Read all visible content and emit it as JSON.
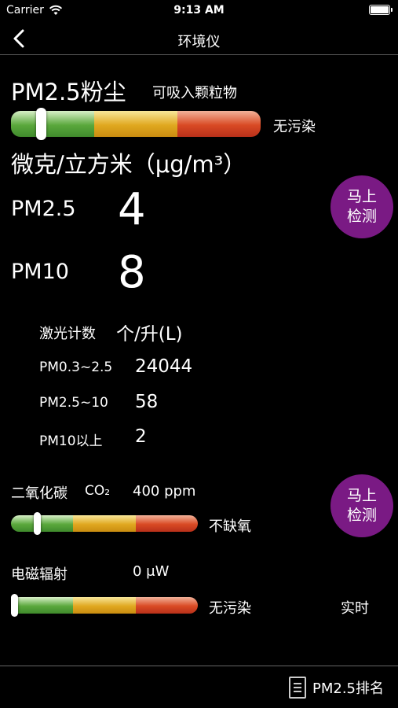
{
  "status_bar": {
    "carrier": "Carrier",
    "time": "9:13 AM"
  },
  "nav": {
    "title": "环境仪",
    "back_icon": "chevron-left-icon"
  },
  "pm_section": {
    "title": "PM2.5粉尘",
    "subtitle": "可吸入颗粒物",
    "gauge_level": 0.1,
    "status": "无污染",
    "unit": "微克/立方米（μg/m³）",
    "pm25_label": "PM2.5",
    "pm25_value": "4",
    "pm10_label": "PM10",
    "pm10_value": "8",
    "detect_button": {
      "line1": "马上",
      "line2": "检测",
      "color": "#7a1a84"
    }
  },
  "laser": {
    "label": "激光计数",
    "unit": "个/升(L)",
    "rows": [
      {
        "label": "PM0.3~2.5",
        "value": "24044"
      },
      {
        "label": "PM2.5~10",
        "value": "58"
      },
      {
        "label": "PM10以上",
        "value": "2"
      }
    ]
  },
  "co2": {
    "label": "二氧化碳",
    "symbol": "CO₂",
    "value": "400 ppm",
    "gauge_level": 0.12,
    "status": "不缺氧",
    "detect_button": {
      "line1": "马上",
      "line2": "检测"
    }
  },
  "em": {
    "label": "电磁辐射",
    "value": "0 μW",
    "gauge_level": 0.0,
    "status": "无污染",
    "mode": "实时"
  },
  "bottom": {
    "rank_label": "PM2.5排名",
    "rank_icon": "list-document-icon"
  },
  "colors": {
    "green": "#5aa83c",
    "yellow": "#e0a820",
    "red": "#d94a24",
    "button": "#7a1a84"
  }
}
